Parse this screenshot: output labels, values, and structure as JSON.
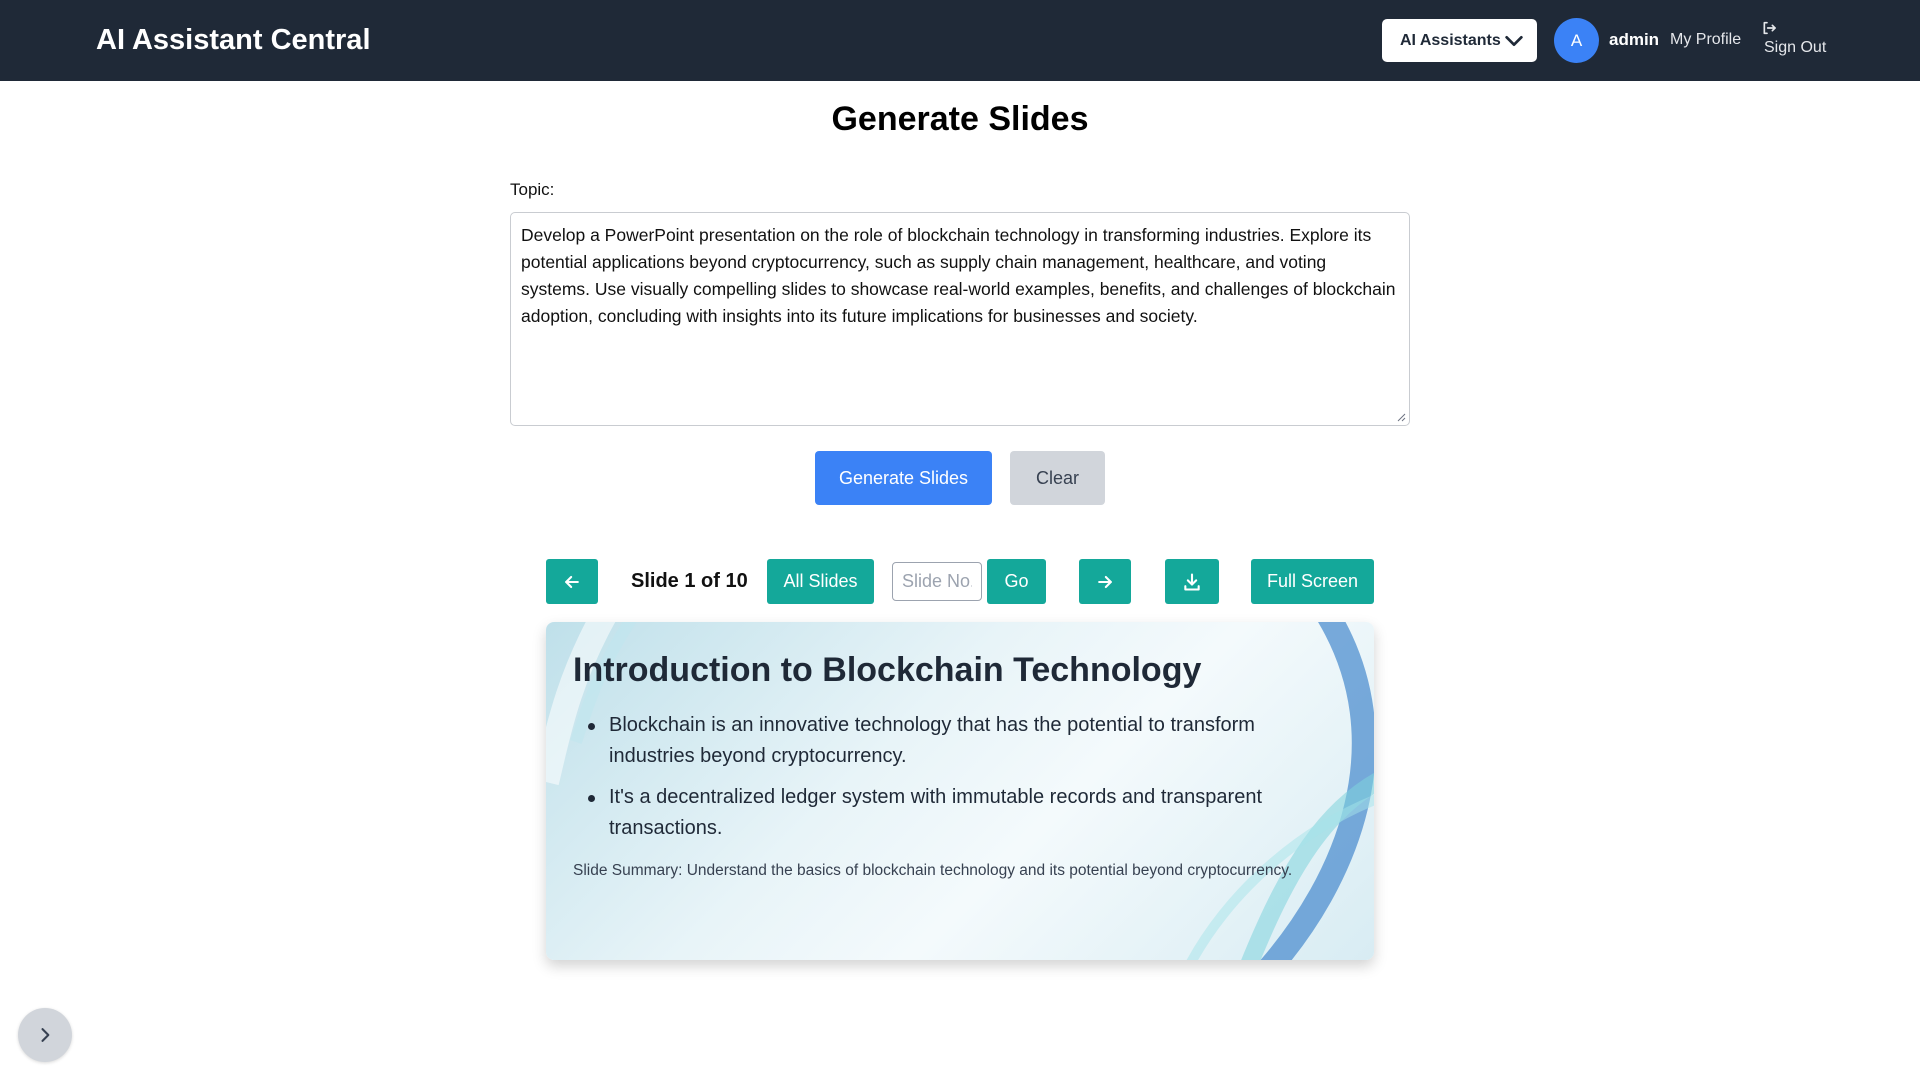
{
  "header": {
    "brand": "AI Assistant Central",
    "assistants_label": "AI Assistants",
    "avatar_initial": "A",
    "username": "admin",
    "profile_label": "My Profile",
    "signout_label": "Sign Out"
  },
  "main": {
    "title": "Generate Slides",
    "topic_label": "Topic:",
    "topic_value": "Develop a PowerPoint presentation on the role of blockchain technology in transforming industries. Explore its potential applications beyond cryptocurrency, such as supply chain management, healthcare, and voting systems. Use visually compelling slides to showcase real-world examples, benefits, and challenges of blockchain adoption, concluding with insights into its future implications for businesses and society.",
    "generate_label": "Generate Slides",
    "clear_label": "Clear"
  },
  "toolbar": {
    "slide_count": "Slide 1 of 10",
    "all_slides_label": "All Slides",
    "slide_no_placeholder": "Slide No.",
    "go_label": "Go",
    "fullscreen_label": "Full Screen",
    "icons": [
      "arrow-left-icon",
      "arrow-right-icon",
      "download-icon"
    ]
  },
  "slide": {
    "title": "Introduction to Blockchain Technology",
    "bullets": [
      "Blockchain is an innovative technology that has the potential to transform industries beyond cryptocurrency.",
      "It's a decentralized ledger system with immutable records and transparent transactions."
    ],
    "summary": "Slide Summary: Understand the basics of blockchain technology and its potential beyond cryptocurrency."
  },
  "colors": {
    "header_bg": "#1f2937",
    "primary": "#3b82f6",
    "teal": "#14a89a",
    "clear_bg": "#d1d5db"
  }
}
